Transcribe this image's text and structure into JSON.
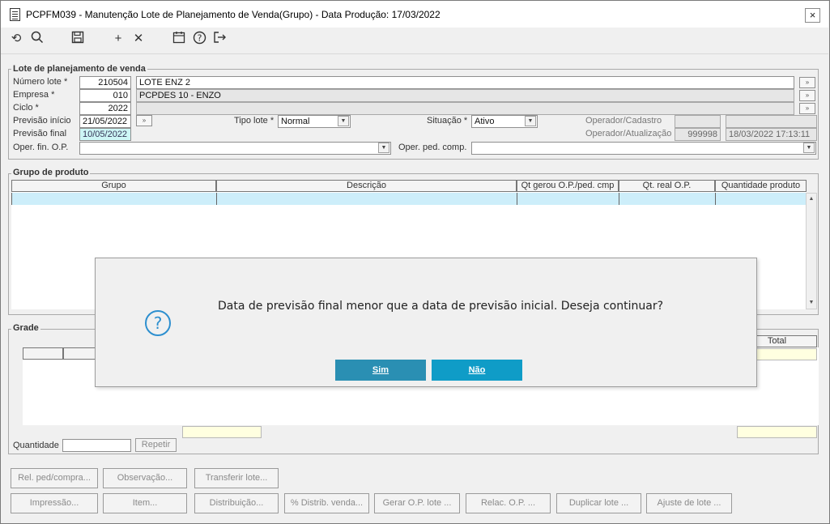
{
  "window": {
    "title": "PCPFM039 - Manutenção Lote de Planejamento de Venda(Grupo) - Data Produção: 17/03/2022",
    "close": "×"
  },
  "toolbar": {
    "refresh": "⟲",
    "search": "⌕",
    "save": "💾",
    "add": "+",
    "delete": "✕",
    "calendar": "📅",
    "help": "?",
    "exit": "⇥"
  },
  "lote": {
    "section_title": "Lote de planejamento de venda",
    "numero_label": "Número lote *",
    "numero_value": "210504",
    "numero_desc": "LOTE ENZ 2",
    "empresa_label": "Empresa *",
    "empresa_value": "010",
    "empresa_desc": "PCPDES 10 - ENZO",
    "ciclo_label": "Ciclo *",
    "ciclo_value": "2022",
    "ciclo_desc": "",
    "prev_inicio_label": "Previsão início",
    "prev_inicio_value": "21/05/2022",
    "prev_final_label": "Previsão final",
    "prev_final_value": "10/05/2022",
    "oper_fin_label": "Oper. fin. O.P.",
    "oper_fin_value": "",
    "tipo_lote_label": "Tipo lote *",
    "tipo_lote_value": "Normal",
    "situacao_label": "Situação *",
    "situacao_value": "Ativo",
    "oper_ped_label": "Oper. ped. comp.",
    "oper_ped_value": "",
    "operador_cadastro_label": "Operador/Cadastro",
    "operador_cadastro_value": "",
    "operador_cadastro_date": "",
    "operador_atualizacao_label": "Operador/Atualização",
    "operador_atualizacao_value": "999998",
    "operador_atualizacao_date": "18/03/2022 17:13:11"
  },
  "grupo": {
    "section_title": "Grupo de produto",
    "columns": [
      "Grupo",
      "Descrição",
      "Qt gerou O.P./ped. cmp",
      "Qt. real O.P.",
      "Quantidade produto"
    ]
  },
  "grade": {
    "section_title": "Grade",
    "total_label": "Total",
    "quantidade_label": "Quantidade",
    "repetir_label": "Repetir"
  },
  "buttons": {
    "row1": [
      "Rel. ped/compra...",
      "Observação...",
      "Transferir lote..."
    ],
    "row2": [
      "Impressão...",
      "Item...",
      "Distribuição...",
      "% Distrib. venda...",
      "Gerar O.P. lote ...",
      "Relac. O.P. ...",
      "Duplicar lote ...",
      "Ajuste de lote ..."
    ]
  },
  "dialog": {
    "message": "Data de previsão final menor que a data de previsão inicial. Deseja continuar?",
    "icon": "?",
    "yes_label": "Sim",
    "no_label": "Não",
    "yes_color": "#2a8fb3",
    "no_color": "#0f9cc7"
  }
}
